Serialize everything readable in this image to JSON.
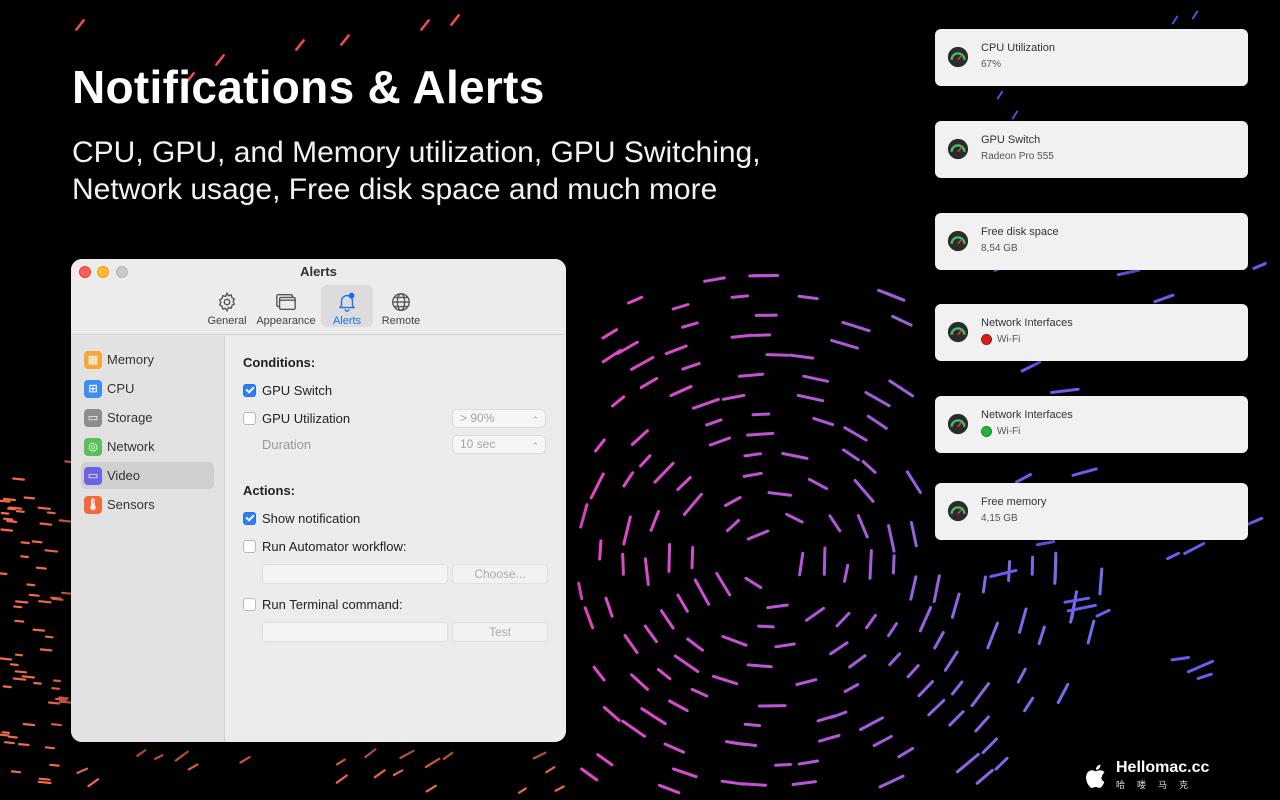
{
  "headline": "Notifications & Alerts",
  "subhead": "CPU, GPU, and Memory utilization, GPU Switching, Network usage, Free disk space and much more",
  "window": {
    "title": "Alerts",
    "toolbar": [
      {
        "label": "General",
        "icon": "gear-icon"
      },
      {
        "label": "Appearance",
        "icon": "appearance-icon"
      },
      {
        "label": "Alerts",
        "icon": "bell-icon",
        "active": true
      },
      {
        "label": "Remote",
        "icon": "globe-icon"
      }
    ],
    "sidebar": [
      {
        "label": "Memory",
        "icon": "memory-icon",
        "color": "#f4a73b"
      },
      {
        "label": "CPU",
        "icon": "cpu-icon",
        "color": "#3d8ef0"
      },
      {
        "label": "Storage",
        "icon": "storage-icon",
        "color": "#8c8c8c"
      },
      {
        "label": "Network",
        "icon": "network-icon",
        "color": "#5cc05a"
      },
      {
        "label": "Video",
        "icon": "video-icon",
        "color": "#6a63e6",
        "selected": true
      },
      {
        "label": "Sensors",
        "icon": "sensors-icon",
        "color": "#f06a3c"
      }
    ],
    "conditions": {
      "title": "Conditions:",
      "gpu_switch": {
        "label": "GPU Switch",
        "checked": true
      },
      "gpu_utilization": {
        "label": "GPU Utilization",
        "checked": false,
        "value": "> 90%"
      },
      "duration": {
        "label": "Duration",
        "value": "10 sec"
      }
    },
    "actions": {
      "title": "Actions:",
      "show_notification": {
        "label": "Show notification",
        "checked": true
      },
      "run_automator": {
        "label": "Run Automator workflow:",
        "checked": false,
        "button": "Choose..."
      },
      "run_terminal": {
        "label": "Run Terminal command:",
        "checked": false,
        "button": "Test"
      }
    }
  },
  "notifications": [
    {
      "title": "CPU Utilization",
      "value": "67%"
    },
    {
      "title": "GPU Switch",
      "value": "Radeon Pro 555"
    },
    {
      "title": "Free disk space",
      "value": "8,54 GB"
    },
    {
      "title": "Network Interfaces",
      "value": "Wi-Fi",
      "status": "red"
    },
    {
      "title": "Network Interfaces",
      "value": "Wi-Fi",
      "status": "green"
    },
    {
      "title": "Free memory",
      "value": "4,15 GB"
    }
  ],
  "watermark": {
    "main": "Hellomac.cc",
    "sub": "哈喽马克"
  },
  "colors": {
    "accent": "#2f7cf6",
    "active_tab": "#1a73e8"
  }
}
